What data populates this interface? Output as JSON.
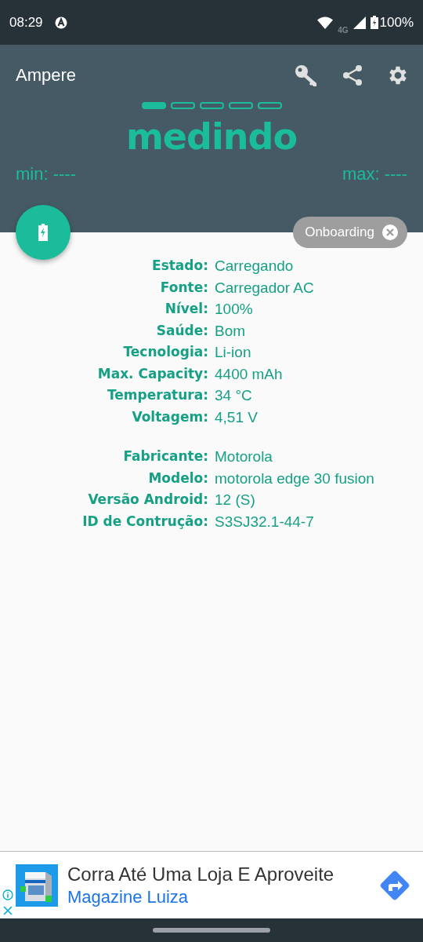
{
  "status_bar": {
    "time": "08:29",
    "network": "4G",
    "battery": "100%"
  },
  "app_bar": {
    "title": "Ampere"
  },
  "pages": [
    {
      "selected": true
    },
    {
      "selected": false
    },
    {
      "selected": false
    },
    {
      "selected": false
    },
    {
      "selected": false
    }
  ],
  "reading": {
    "value": "medindo",
    "min": "min: ----",
    "max": "max: ----"
  },
  "chip": {
    "label": "Onboarding"
  },
  "sections": [
    {
      "rows": [
        {
          "label": "Estado:",
          "value": "Carregando"
        },
        {
          "label": "Fonte:",
          "value": "Carregador AC"
        },
        {
          "label": "Nível:",
          "value": "100%"
        },
        {
          "label": "Saúde:",
          "value": "Bom"
        },
        {
          "label": "Tecnologia:",
          "value": "Li-ion"
        },
        {
          "label": "Max. Capacity:",
          "value": "4400 mAh"
        },
        {
          "label": "Temperatura:",
          "value": "34 °C"
        },
        {
          "label": "Voltagem:",
          "value": "4,51 V"
        }
      ]
    },
    {
      "rows": [
        {
          "label": "Fabricante:",
          "value": "Motorola"
        },
        {
          "label": "Modelo:",
          "value": "motorola edge 30 fusion"
        },
        {
          "label": "Versão Android:",
          "value": "12 (S)"
        },
        {
          "label": "ID de Contrução:",
          "value": "S3SJ32.1-44-7"
        }
      ]
    }
  ],
  "ad": {
    "headline": "Corra Até Uma Loja E Aproveite",
    "advertiser": "Magazine Luiza"
  }
}
